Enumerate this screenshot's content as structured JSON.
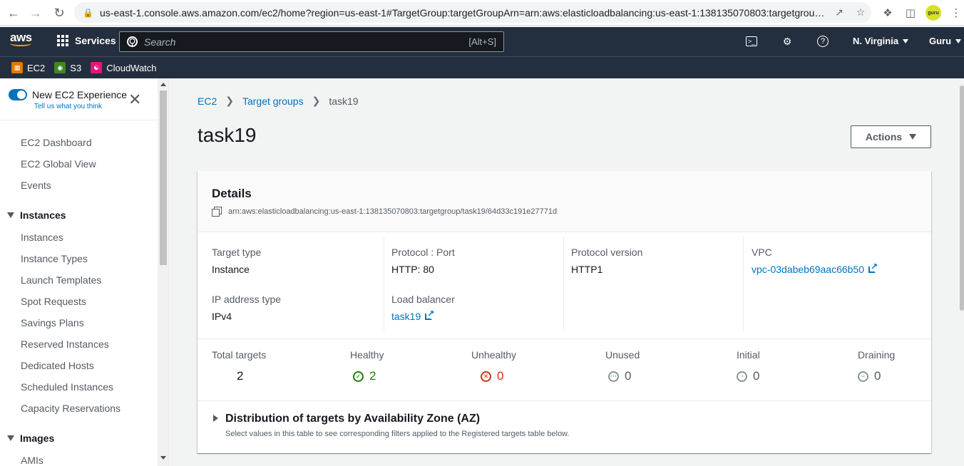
{
  "browser": {
    "url": "us-east-1.console.aws.amazon.com/ec2/home?region=us-east-1#TargetGroup:targetGroupArn=arn:aws:elasticloadbalancing:us-east-1:138135070803:targetgroup/...",
    "guru_badge": "guru"
  },
  "topnav": {
    "logo_text": "aws",
    "services_label": "Services",
    "search_placeholder": "Search",
    "search_shortcut": "[Alt+S]",
    "region": "N. Virginia",
    "user": "Guru"
  },
  "favorites": [
    {
      "label": "EC2",
      "color": "#e07b00"
    },
    {
      "label": "S3",
      "color": "#3f8624"
    },
    {
      "label": "CloudWatch",
      "color": "#e7157b"
    }
  ],
  "sidebar": {
    "new_experience_title": "New EC2 Experience",
    "new_experience_sub": "Tell us what you think",
    "top_items": [
      "EC2 Dashboard",
      "EC2 Global View",
      "Events"
    ],
    "instances_heading": "Instances",
    "instances_items": [
      "Instances",
      "Instance Types",
      "Launch Templates",
      "Spot Requests",
      "Savings Plans",
      "Reserved Instances",
      "Dedicated Hosts",
      "Scheduled Instances",
      "Capacity Reservations"
    ],
    "images_heading": "Images",
    "images_items": [
      "AMIs"
    ]
  },
  "breadcrumb": {
    "root": "EC2",
    "parent": "Target groups",
    "current": "task19"
  },
  "page": {
    "title": "task19",
    "actions_label": "Actions"
  },
  "details": {
    "title": "Details",
    "arn": "arn:aws:elasticloadbalancing:us-east-1:138135070803:targetgroup/task19/64d33c191e27771d",
    "target_type_label": "Target type",
    "target_type": "Instance",
    "ip_type_label": "IP address type",
    "ip_type": "IPv4",
    "protocol_label": "Protocol : Port",
    "protocol": "HTTP: 80",
    "lb_label": "Load balancer",
    "lb": "task19",
    "protocol_version_label": "Protocol version",
    "protocol_version": "HTTP1",
    "vpc_label": "VPC",
    "vpc": "vpc-03dabeb69aac66b50"
  },
  "stats": {
    "total_label": "Total targets",
    "total": "2",
    "healthy_label": "Healthy",
    "healthy": "2",
    "unhealthy_label": "Unhealthy",
    "unhealthy": "0",
    "unused_label": "Unused",
    "unused": "0",
    "initial_label": "Initial",
    "initial": "0",
    "draining_label": "Draining",
    "draining": "0"
  },
  "distribution": {
    "title": "Distribution of targets by Availability Zone (AZ)",
    "description": "Select values in this table to see corresponding filters applied to the Registered targets table below."
  },
  "colors": {
    "link": "#0073bb",
    "healthy": "#1d8102",
    "unhealthy": "#d13212",
    "muted": "#879596",
    "nav_bg": "#232f3e"
  }
}
